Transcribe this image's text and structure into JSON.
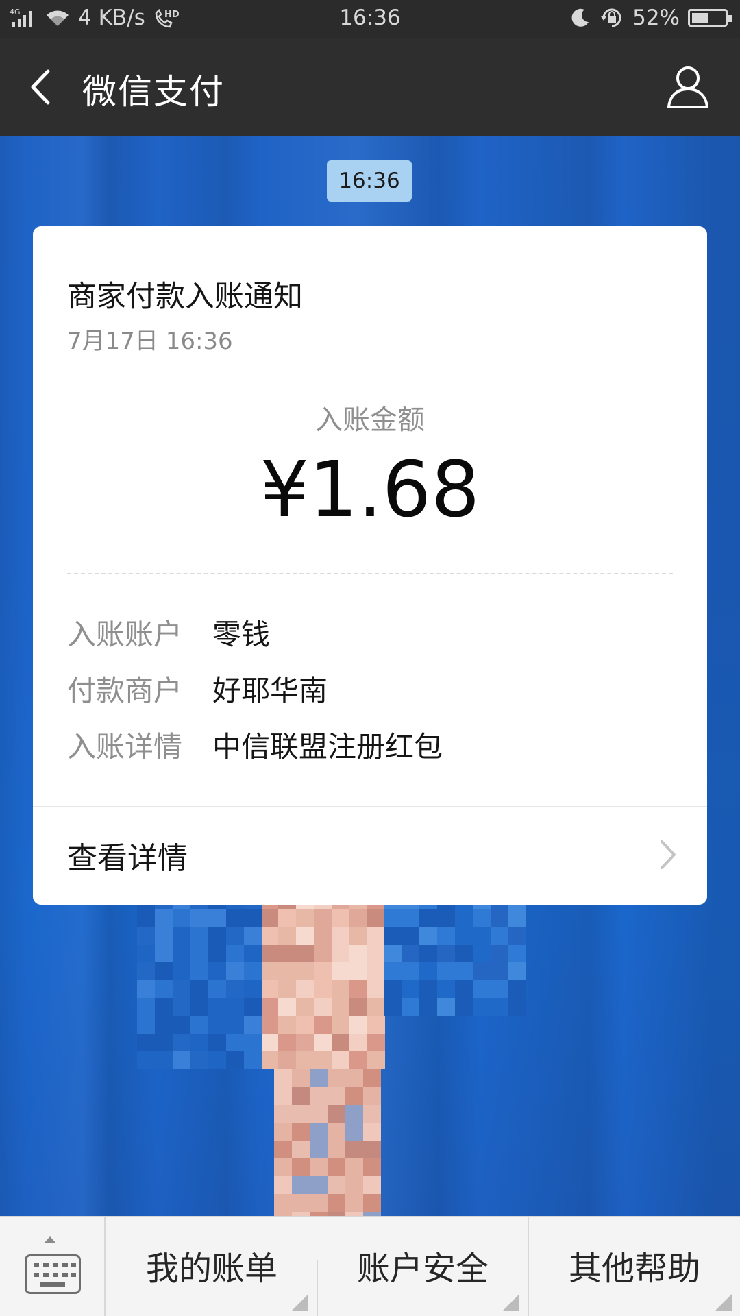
{
  "status_bar": {
    "network": "4G",
    "speed": "4 KB/s",
    "hd": "HD",
    "time": "16:36",
    "battery": "52%",
    "battery_level": 0.52
  },
  "header": {
    "title": "微信支付",
    "back_icon": "chevron-left-icon",
    "profile_icon": "person-icon"
  },
  "chat": {
    "timestamp": "16:36"
  },
  "card": {
    "title": "商家付款入账通知",
    "date": "7月17日  16:36",
    "amount_label": "入账金额",
    "amount": "¥1.68",
    "rows": [
      {
        "key": "入账账户",
        "value": "零钱"
      },
      {
        "key": "付款商户",
        "value": "好耶华南"
      },
      {
        "key": "入账详情",
        "value": "中信联盟注册红包"
      }
    ],
    "detail_link": "查看详情"
  },
  "bottom_menu": {
    "keyboard_icon": "keyboard-icon",
    "items": [
      {
        "label": "我的账单"
      },
      {
        "label": "账户安全"
      },
      {
        "label": "其他帮助"
      }
    ]
  },
  "colors": {
    "title_bar": "#2e2e2e",
    "wallpaper": "#1d63c8",
    "time_bubble": "#a9d2f2"
  }
}
